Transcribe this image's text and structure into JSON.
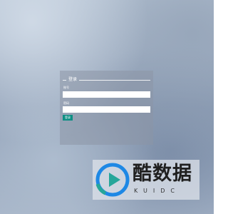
{
  "login": {
    "legend_title": "登录",
    "username_label": "账号",
    "username_value": "",
    "password_label": "密码",
    "password_value": "",
    "submit_label": "登录"
  },
  "watermark": {
    "name_cn": "酷数据",
    "name_en": "KUIDC",
    "logo_icon": "play-logo-icon"
  },
  "colors": {
    "submit_bg": "#0f8f84",
    "logo_blue": "#1e88e5",
    "logo_teal": "#26a69a"
  }
}
